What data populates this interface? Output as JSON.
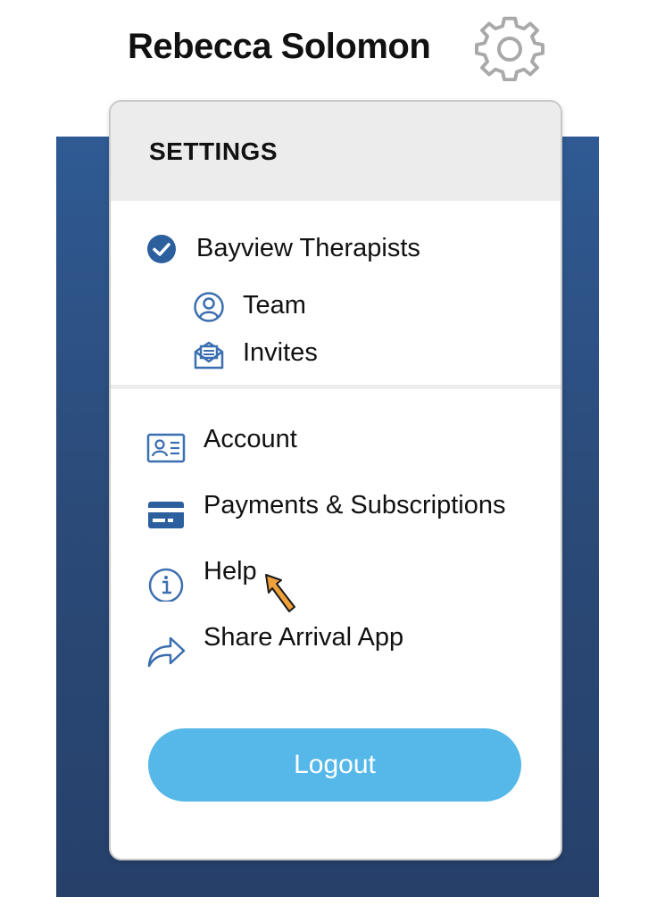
{
  "header": {
    "user_name": "Rebecca Solomon"
  },
  "settings": {
    "title": "SETTINGS",
    "organization": {
      "name": "Bayview Therapists",
      "items": [
        {
          "label": "Team",
          "icon": "user-circle-icon"
        },
        {
          "label": "Invites",
          "icon": "envelope-open-icon"
        }
      ]
    },
    "menu": [
      {
        "label": "Account",
        "icon": "id-card-icon"
      },
      {
        "label": "Payments & Subscriptions",
        "icon": "credit-card-icon"
      },
      {
        "label": "Help",
        "icon": "info-circle-icon"
      },
      {
        "label": "Share Arrival App",
        "icon": "share-arrow-icon"
      }
    ],
    "logout_label": "Logout"
  },
  "colors": {
    "accent_blue": "#2f5a93",
    "logout_button": "#55b8e8",
    "icon_blue": "#3b6fb0",
    "check_blue": "#2c5f9e",
    "cursor_orange": "#f0a13a"
  }
}
